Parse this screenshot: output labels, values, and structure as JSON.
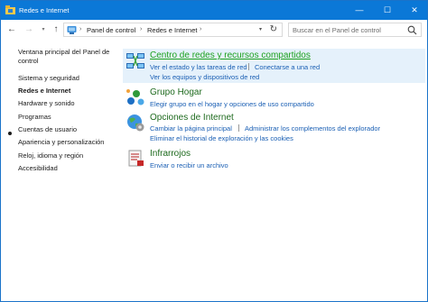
{
  "window": {
    "title": "Redes e Internet",
    "controls": {
      "minimize": "—",
      "maximize": "☐",
      "close": "✕"
    }
  },
  "navigation": {
    "breadcrumb": [
      "Panel de control",
      "Redes e Internet"
    ],
    "search_placeholder": "Buscar en el Panel de control"
  },
  "sidebar": {
    "items": [
      {
        "label": "Ventana principal del Panel de control",
        "active": false
      },
      {
        "label": "Sistema y seguridad",
        "active": false
      },
      {
        "label": "Redes e Internet",
        "active": true
      },
      {
        "label": "Hardware y sonido",
        "active": false
      },
      {
        "label": "Programas",
        "active": false
      },
      {
        "label": "Cuentas de usuario",
        "active": false
      },
      {
        "label": "Apariencia y personalización",
        "active": false
      },
      {
        "label": "Reloj, idioma y región",
        "active": false
      },
      {
        "label": "Accesibilidad",
        "active": false
      }
    ]
  },
  "categories": [
    {
      "icon": "network-center-icon",
      "heading": "Centro de redes y recursos compartidos",
      "links": [
        "Ver el estado y las tareas de red",
        "Conectarse a una red",
        "Ver los equipos y dispositivos de red"
      ]
    },
    {
      "icon": "homegroup-icon",
      "heading": "Grupo Hogar",
      "links": [
        "Elegir grupo en el hogar y opciones de uso compartido"
      ]
    },
    {
      "icon": "internet-options-icon",
      "heading": "Opciones de Internet",
      "links": [
        "Cambiar la página principal",
        "Administrar los complementos del explorador",
        "Eliminar el historial de exploración y las cookies"
      ]
    },
    {
      "icon": "infrared-icon",
      "heading": "Infrarrojos",
      "links": [
        "Enviar o recibir un archivo"
      ]
    }
  ],
  "colors": {
    "titlebar": "#0b78d7",
    "link": "#1a5fb4",
    "heading": "#1e6a1e",
    "heading_hover": "#1ea11e",
    "highlight": "#e5f1fb"
  }
}
